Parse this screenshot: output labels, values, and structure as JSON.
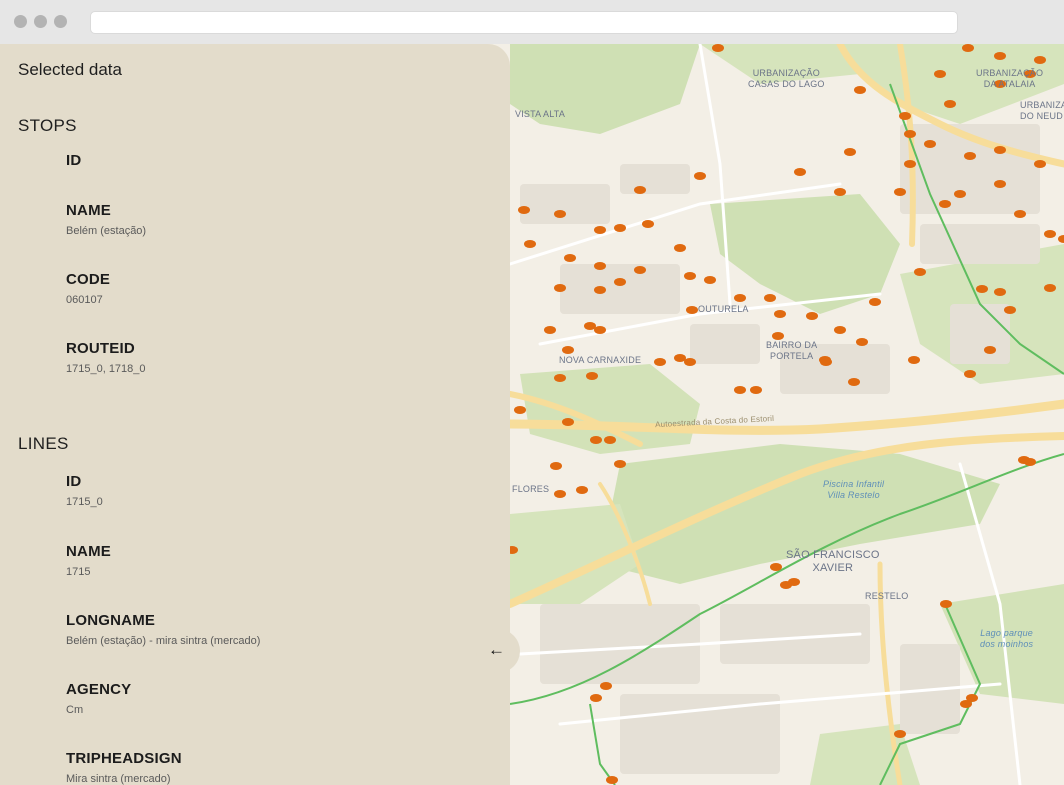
{
  "panel": {
    "title": "Selected data",
    "stops": {
      "heading": "STOPS",
      "fields": [
        {
          "name": "ID",
          "value": ""
        },
        {
          "name": "NAME",
          "value": "Belém (estação)"
        },
        {
          "name": "CODE",
          "value": "060107"
        },
        {
          "name": "ROUTEID",
          "value": "1715_0, 1718_0"
        }
      ]
    },
    "lines": {
      "heading": "LINES",
      "fields": [
        {
          "name": "ID",
          "value": "1715_0"
        },
        {
          "name": "NAME",
          "value": "1715"
        },
        {
          "name": "LONGNAME",
          "value": "Belém (estação) - mira sintra (mercado)"
        },
        {
          "name": "AGENCY",
          "value": "Cm"
        },
        {
          "name": "TRIPHEADSIGN",
          "value": "Mira sintra (mercado)"
        }
      ]
    },
    "collapse_icon": "arrow-left-icon",
    "collapse_glyph": "←"
  },
  "map": {
    "labels": {
      "urbanizacao_casas_do_lago": "URBANIZAÇÃO\nCASAS DO LAGO",
      "urbanizacao_da_atalaia": "URBANIZAÇÃO\nDA ATALAIA",
      "urbaniza_do_neud": "URBANIZA\nDO NEUD",
      "vista_alta": "VISTA ALTA",
      "outurela": "OUTURELA",
      "bairro_da_portela": "BAIRRO DA\nPORTELA",
      "nova_carnaxide": "NOVA CARNAXIDE",
      "flores": "FLORES",
      "sao_francisco_xavier": "SÃO FRANCISCO\nXAVIER",
      "restelo": "RESTELO",
      "piscina": "Piscina Infantil\nVilla Restelo",
      "lago": "Lago parque\ndos moinhos",
      "autoestrada": "Autoestrada da Costa do Estoril"
    },
    "stop_color": "#e06a10"
  }
}
